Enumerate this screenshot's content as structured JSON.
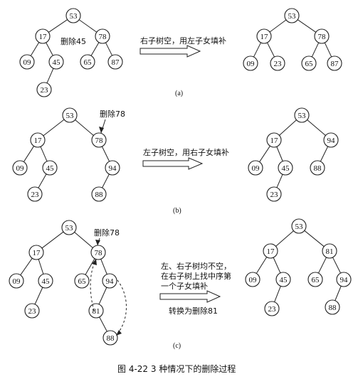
{
  "figure_caption": "图 4-22   3 种情况下的删除过程",
  "panels": [
    {
      "sublabel": "(a)",
      "instruction_lines": [
        "右子树空，用左子女填补"
      ],
      "delete_note": "删除45",
      "before": {
        "nodes": [
          {
            "id": "n53",
            "label": "53"
          },
          {
            "id": "n17",
            "label": "17"
          },
          {
            "id": "n78",
            "label": "78"
          },
          {
            "id": "n09",
            "label": "09"
          },
          {
            "id": "n45",
            "label": "45"
          },
          {
            "id": "n65",
            "label": "65"
          },
          {
            "id": "n87",
            "label": "87"
          },
          {
            "id": "n23",
            "label": "23"
          }
        ],
        "edges": [
          [
            "n53",
            "n17"
          ],
          [
            "n53",
            "n78"
          ],
          [
            "n17",
            "n09"
          ],
          [
            "n17",
            "n45"
          ],
          [
            "n78",
            "n65"
          ],
          [
            "n78",
            "n87"
          ],
          [
            "n45",
            "n23"
          ]
        ]
      },
      "after": {
        "nodes": [
          {
            "id": "m53",
            "label": "53"
          },
          {
            "id": "m17",
            "label": "17"
          },
          {
            "id": "m78",
            "label": "78"
          },
          {
            "id": "m09",
            "label": "09"
          },
          {
            "id": "m23",
            "label": "23"
          },
          {
            "id": "m65",
            "label": "65"
          },
          {
            "id": "m87",
            "label": "87"
          }
        ],
        "edges": [
          [
            "m53",
            "m17"
          ],
          [
            "m53",
            "m78"
          ],
          [
            "m17",
            "m09"
          ],
          [
            "m17",
            "m23"
          ],
          [
            "m78",
            "m65"
          ],
          [
            "m78",
            "m87"
          ]
        ]
      }
    },
    {
      "sublabel": "(b)",
      "instruction_lines": [
        "左子树空，用右子女填补"
      ],
      "delete_note": "删除78",
      "before": {
        "nodes": [
          {
            "id": "p53",
            "label": "53"
          },
          {
            "id": "p17",
            "label": "17"
          },
          {
            "id": "p78",
            "label": "78"
          },
          {
            "id": "p09",
            "label": "09"
          },
          {
            "id": "p45",
            "label": "45"
          },
          {
            "id": "p94",
            "label": "94"
          },
          {
            "id": "p23",
            "label": "23"
          },
          {
            "id": "p88",
            "label": "88"
          }
        ],
        "edges": [
          [
            "p53",
            "p17"
          ],
          [
            "p53",
            "p78"
          ],
          [
            "p17",
            "p09"
          ],
          [
            "p17",
            "p45"
          ],
          [
            "p78",
            "p94"
          ],
          [
            "p45",
            "p23"
          ],
          [
            "p94",
            "p88"
          ]
        ]
      },
      "after": {
        "nodes": [
          {
            "id": "q53",
            "label": "53"
          },
          {
            "id": "q17",
            "label": "17"
          },
          {
            "id": "q94",
            "label": "94"
          },
          {
            "id": "q09",
            "label": "09"
          },
          {
            "id": "q45",
            "label": "45"
          },
          {
            "id": "q88",
            "label": "88"
          },
          {
            "id": "q23",
            "label": "23"
          }
        ],
        "edges": [
          [
            "q53",
            "q17"
          ],
          [
            "q53",
            "q94"
          ],
          [
            "q17",
            "q09"
          ],
          [
            "q17",
            "q45"
          ],
          [
            "q94",
            "q88"
          ],
          [
            "q45",
            "q23"
          ]
        ]
      }
    },
    {
      "sublabel": "(c)",
      "instruction_lines": [
        "左、右子树均不空，",
        "在右子树上找中序第",
        "一个子女填补"
      ],
      "convert_note": "转换为删除81",
      "delete_note": "删除78",
      "before": {
        "nodes": [
          {
            "id": "r53",
            "label": "53"
          },
          {
            "id": "r17",
            "label": "17"
          },
          {
            "id": "r78",
            "label": "78"
          },
          {
            "id": "r09",
            "label": "09"
          },
          {
            "id": "r45",
            "label": "45"
          },
          {
            "id": "r65",
            "label": "65"
          },
          {
            "id": "r94",
            "label": "94"
          },
          {
            "id": "r23",
            "label": "23"
          },
          {
            "id": "r81",
            "label": "81"
          },
          {
            "id": "r88",
            "label": "88"
          }
        ],
        "edges": [
          [
            "r53",
            "r17"
          ],
          [
            "r53",
            "r78"
          ],
          [
            "r17",
            "r09"
          ],
          [
            "r17",
            "r45"
          ],
          [
            "r78",
            "r65"
          ],
          [
            "r78",
            "r94"
          ],
          [
            "r45",
            "r23"
          ],
          [
            "r94",
            "r81"
          ],
          [
            "r81",
            "r88"
          ]
        ]
      },
      "after": {
        "nodes": [
          {
            "id": "s53",
            "label": "53"
          },
          {
            "id": "s17",
            "label": "17"
          },
          {
            "id": "s81",
            "label": "81"
          },
          {
            "id": "s09",
            "label": "09"
          },
          {
            "id": "s45",
            "label": "45"
          },
          {
            "id": "s65",
            "label": "65"
          },
          {
            "id": "s94",
            "label": "94"
          },
          {
            "id": "s23",
            "label": "23"
          },
          {
            "id": "s88",
            "label": "88"
          }
        ],
        "edges": [
          [
            "s53",
            "s17"
          ],
          [
            "s53",
            "s81"
          ],
          [
            "s17",
            "s09"
          ],
          [
            "s17",
            "s45"
          ],
          [
            "s81",
            "s65"
          ],
          [
            "s81",
            "s94"
          ],
          [
            "s45",
            "s23"
          ],
          [
            "s94",
            "s88"
          ]
        ]
      }
    }
  ]
}
